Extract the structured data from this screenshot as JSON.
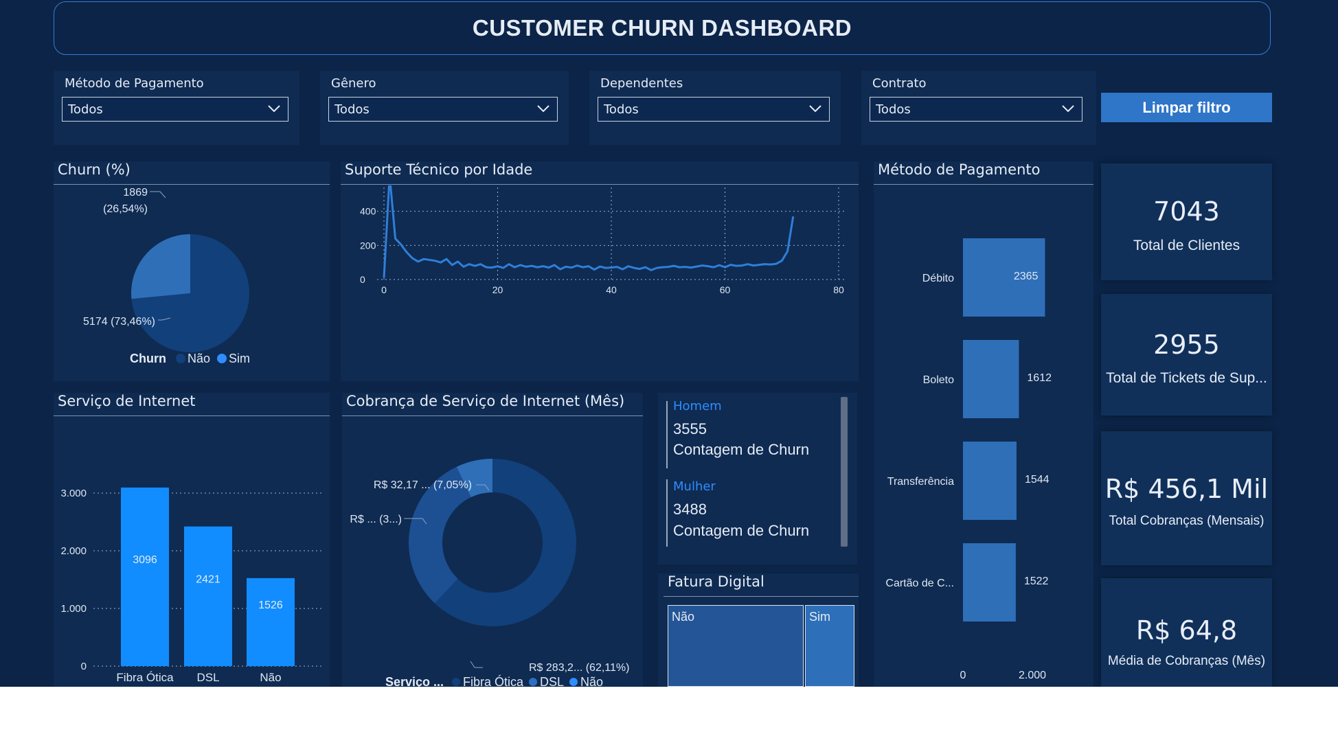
{
  "title": "CUSTOMER CHURN DASHBOARD",
  "filters": [
    {
      "label": "Método de Pagamento",
      "value": "Todos"
    },
    {
      "label": "Gênero",
      "value": "Todos"
    },
    {
      "label": "Dependentes",
      "value": "Todos"
    },
    {
      "label": "Contrato",
      "value": "Todos"
    }
  ],
  "clear_button": "Limpar filtro",
  "kpis": [
    {
      "value": "7043",
      "label": "Total de Clientes"
    },
    {
      "value": "2955",
      "label": "Total de Tickets de Sup..."
    },
    {
      "value": "R$ 456,1 Mil",
      "label": "Total Cobranças (Mensais)"
    },
    {
      "value": "R$ 64,8",
      "label": "Média de Cobranças (Mês)"
    }
  ],
  "gender_card": {
    "items": [
      {
        "label": "Homem",
        "value": "3555",
        "measure": "Contagem de Churn"
      },
      {
        "label": "Mulher",
        "value": "3488",
        "measure": "Contagem de Churn"
      }
    ]
  },
  "colors": {
    "accent": "#2f75c8",
    "bar": "#118dff",
    "dark_slice": "#12407b",
    "light_slice": "#2e6fb8"
  },
  "chart_data": [
    {
      "type": "pie",
      "title": "Churn (%)",
      "legend_title": "Churn",
      "labels": [
        "Não",
        "Sim"
      ],
      "values": [
        5174,
        1869
      ],
      "data_labels": [
        "5174 (73,46%)",
        "1869",
        "(26,54%)"
      ]
    },
    {
      "type": "line",
      "title": "Suporte Técnico por Idade",
      "xlim": [
        0,
        80
      ],
      "ylim": [
        0,
        650
      ],
      "xticks": [
        "0",
        "20",
        "40",
        "60",
        "80"
      ],
      "yticks": [
        "0",
        "200",
        "400",
        "600"
      ],
      "x": [
        0,
        1,
        2,
        3,
        4,
        5,
        6,
        7,
        8,
        9,
        10,
        11,
        12,
        13,
        14,
        15,
        16,
        17,
        18,
        19,
        20,
        21,
        22,
        23,
        24,
        25,
        26,
        27,
        28,
        29,
        30,
        31,
        32,
        33,
        34,
        35,
        36,
        37,
        38,
        39,
        40,
        41,
        42,
        43,
        44,
        45,
        46,
        47,
        48,
        49,
        50,
        51,
        52,
        53,
        54,
        55,
        56,
        57,
        58,
        59,
        60,
        61,
        62,
        63,
        64,
        65,
        66,
        67,
        68,
        69,
        70,
        71,
        72
      ],
      "y": [
        10,
        610,
        240,
        205,
        160,
        125,
        105,
        120,
        115,
        110,
        100,
        120,
        85,
        105,
        75,
        90,
        80,
        90,
        72,
        70,
        78,
        68,
        90,
        72,
        85,
        75,
        80,
        72,
        78,
        70,
        85,
        60,
        75,
        70,
        82,
        72,
        78,
        58,
        76,
        68,
        70,
        74,
        60,
        78,
        68,
        62,
        72,
        55,
        68,
        72,
        74,
        80,
        72,
        74,
        70,
        76,
        82,
        78,
        72,
        84,
        72,
        86,
        80,
        82,
        90,
        82,
        86,
        90,
        88,
        92,
        110,
        165,
        370
      ],
      "grid": true
    },
    {
      "type": "bar",
      "orientation": "horizontal",
      "title": "Método de Pagamento",
      "categories": [
        "Débito",
        "Boleto",
        "Transferência",
        "Cartão de C..."
      ],
      "values": [
        2365,
        1612,
        1544,
        1522
      ],
      "xlim": [
        0,
        2400
      ],
      "xticks": [
        "0",
        "2.000"
      ]
    },
    {
      "type": "bar",
      "title": "Serviço de Internet",
      "categories": [
        "Fibra Ótica",
        "DSL",
        "Não"
      ],
      "values": [
        3096,
        2421,
        1526
      ],
      "ylim": [
        0,
        3300
      ],
      "yticks": [
        "0",
        "1.000",
        "2.000",
        "3.000"
      ],
      "grid": true
    },
    {
      "type": "pie",
      "variant": "donut",
      "title": "Cobrança de Serviço de Internet (Mês)",
      "legend_title": "Serviço ...",
      "labels": [
        "Fibra Ótica",
        "DSL",
        "Não"
      ],
      "values": [
        62.11,
        30.84,
        7.05
      ],
      "data_labels": [
        "R$ 283,2... (62,11%)",
        "R$ ... (3...)",
        "R$ 32,17 ... (7,05%)"
      ]
    },
    {
      "type": "heatmap",
      "variant": "treemap",
      "title": "Fatura Digital",
      "labels": [
        "Não",
        "Sim"
      ],
      "values": [
        73,
        27
      ]
    }
  ]
}
